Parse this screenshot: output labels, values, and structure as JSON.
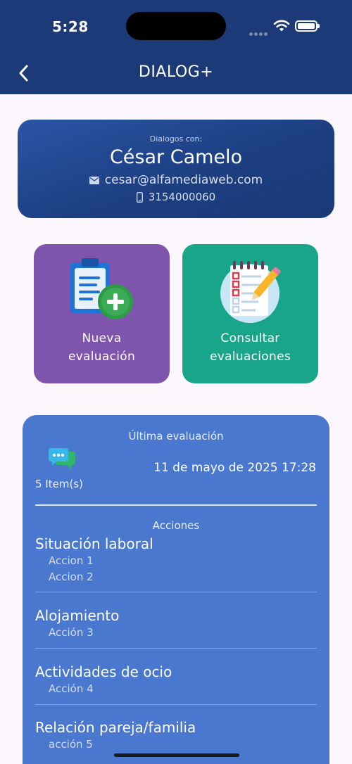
{
  "status": {
    "time": "5:28"
  },
  "appbar": {
    "title": "DIALOG+"
  },
  "contact": {
    "label": "Dialogos con:",
    "name": "César Camelo",
    "email": "cesar@alfamediaweb.com",
    "phone": "3154000060"
  },
  "tiles": {
    "new": {
      "line1": "Nueva",
      "line2": "evaluación"
    },
    "consult": {
      "line1": "Consultar",
      "line2": "evaluaciones"
    }
  },
  "last_eval": {
    "title": "Última evaluación",
    "items_count": "5 Item(s)",
    "date": "11 de mayo de 2025 17:28",
    "actions_label": "Acciones",
    "sections": [
      {
        "heading": "Situación laboral",
        "actions": [
          "Accion 1",
          "Accion 2"
        ]
      },
      {
        "heading": "Alojamiento",
        "actions": [
          "Acción 3"
        ]
      },
      {
        "heading": "Actividades de ocio",
        "actions": [
          "Acción 4"
        ]
      },
      {
        "heading": "Relación pareja/familia",
        "actions": [
          "acción 5"
        ]
      }
    ]
  },
  "colors": {
    "appbar": "#1c3a78",
    "panel": "#4a78cf",
    "tile_purple": "#7f54ad",
    "tile_green": "#19a58a"
  },
  "icons": [
    "wifi-icon",
    "battery-icon",
    "back-arrow-icon",
    "mail-icon",
    "phone-icon",
    "clipboard-add-icon",
    "checklist-icon",
    "chat-bubbles-icon"
  ]
}
